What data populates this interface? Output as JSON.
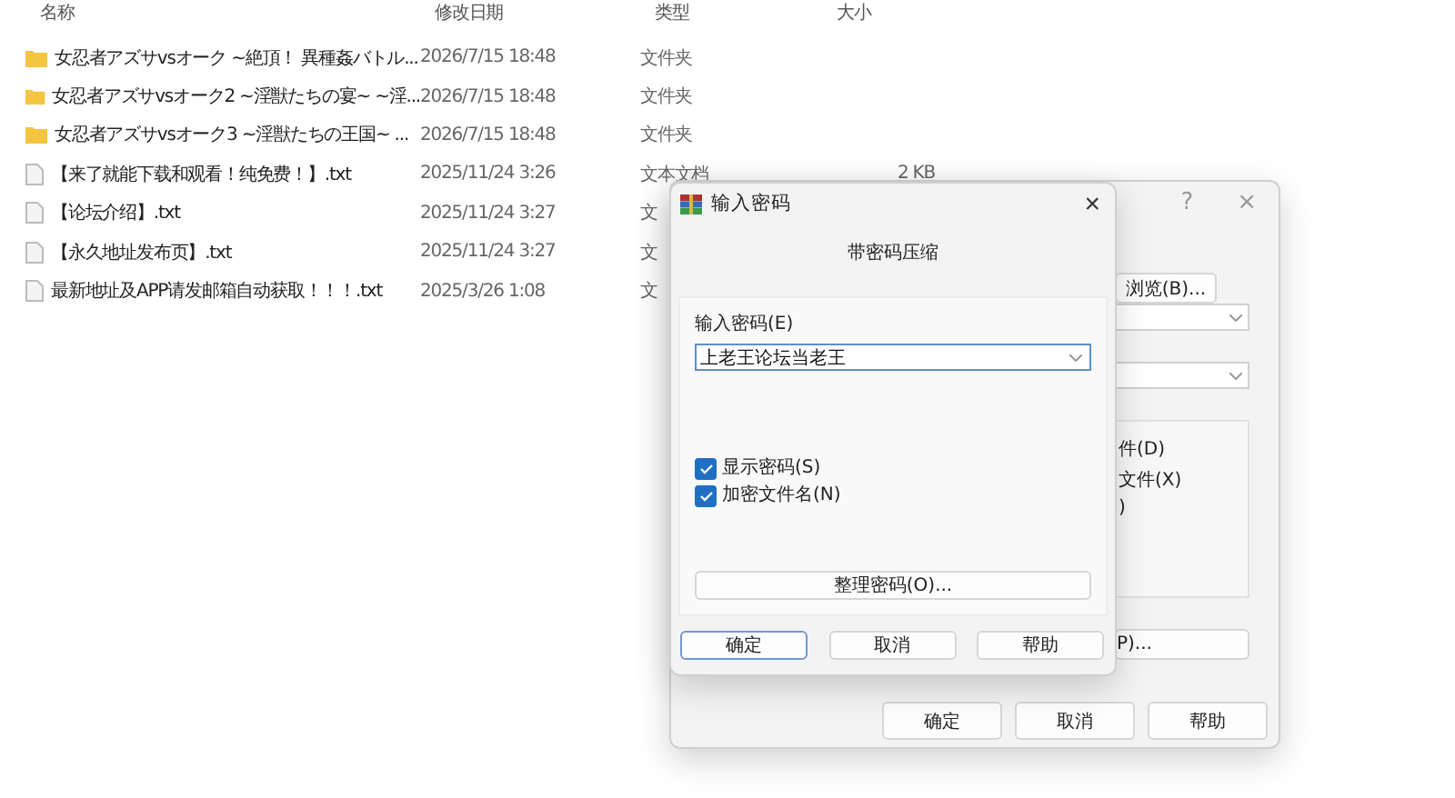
{
  "file_list": {
    "columns": [
      "名称",
      "修改日期",
      "类型",
      "大小"
    ],
    "rows": [
      {
        "kind": "folder",
        "name": "女忍者アズサvsオーク ~絶頂！ 異種姦バトル...",
        "date": "2026/7/15 18:48",
        "type": "文件夹"
      },
      {
        "kind": "folder",
        "name": "女忍者アズサvsオーク2 ~淫獣たちの宴~ ~淫...",
        "date": "2026/7/15 18:48",
        "type": "文件夹"
      },
      {
        "kind": "folder",
        "name": "女忍者アズサvsオーク3 ~淫獣たちの王国~ ...",
        "date": "2026/7/15 18:48",
        "type": "文件夹"
      },
      {
        "kind": "file",
        "name": "【来了就能下载和观看！纯免费！】.txt",
        "date": "2025/11/24 3:26",
        "type": "文本文档",
        "size": "2 KB"
      },
      {
        "kind": "file",
        "name": "【论坛介绍】.txt",
        "date": "2025/11/24 3:27",
        "type": "文"
      },
      {
        "kind": "file",
        "name": "【永久地址发布页】.txt",
        "date": "2025/11/24 3:27",
        "type": "文"
      },
      {
        "kind": "file",
        "name": "最新地址及APP请发邮箱自动获取！！！.txt",
        "date": "2025/3/26 1:08",
        "type": "文"
      }
    ]
  },
  "back_dialog": {
    "title_buttons": [
      "?",
      "×"
    ],
    "browse_button": "浏览(B)...",
    "options": [
      "件(D)",
      "文件(X)",
      ")"
    ],
    "side_button": "P)...",
    "buttons": [
      "确定",
      "取消",
      "帮助"
    ]
  },
  "password_dialog": {
    "title": "输入密码",
    "close_glyph": "×",
    "subtitle": "带密码压缩",
    "field_label": "输入密码(E)",
    "password": "上老王论坛当老王",
    "checkboxes": [
      {
        "label": "显示密码(S)",
        "checked": true
      },
      {
        "label": "加密文件名(N)",
        "checked": true
      }
    ],
    "organize_button": "整理密码(O)...",
    "buttons": [
      {
        "label": "确定",
        "selected": true
      },
      {
        "label": "取消",
        "selected": false
      },
      {
        "label": "帮助",
        "selected": false
      }
    ]
  }
}
